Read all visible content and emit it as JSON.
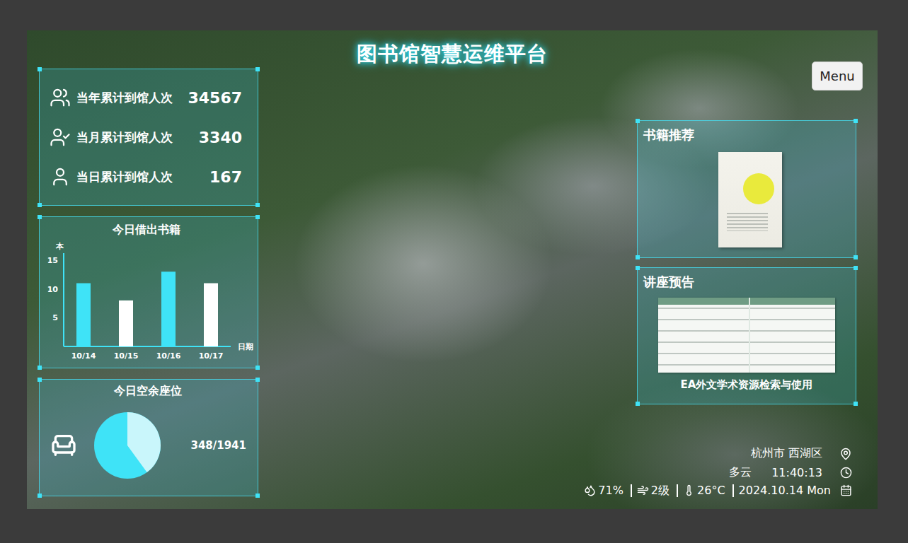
{
  "title": "图书馆智慧运维平台",
  "menu_button": "Menu",
  "stats": [
    {
      "label": "当年累计到馆人次",
      "value": "34567"
    },
    {
      "label": "当月累计到馆人次",
      "value": "3340"
    },
    {
      "label": "当日累计到馆人次",
      "value": "167"
    }
  ],
  "borrow_chart": {
    "title": "今日借出书籍",
    "unit": "本",
    "y_ticks": [
      "5",
      "10",
      "15"
    ],
    "x_title": "日期",
    "categories": [
      "10/14",
      "10/15",
      "10/16",
      "10/17"
    ],
    "values": [
      11,
      8,
      13,
      11
    ],
    "colors": [
      "#3fe3f7",
      "#ffffff",
      "#3fe3f7",
      "#ffffff"
    ]
  },
  "seats": {
    "title": "今日空余座位",
    "reading": "348/1941",
    "level": 0.4
  },
  "book_panel": {
    "title": "书籍推荐"
  },
  "lecture_panel": {
    "title": "讲座预告",
    "caption": "EA外文学术资源检索与使用"
  },
  "info": {
    "location": "杭州市 西湖区",
    "weather": "多云",
    "time": "11:40:13",
    "humidity": "71%",
    "wind": "2级",
    "temperature": "26°C",
    "date": "2024.10.14 Mon"
  }
}
